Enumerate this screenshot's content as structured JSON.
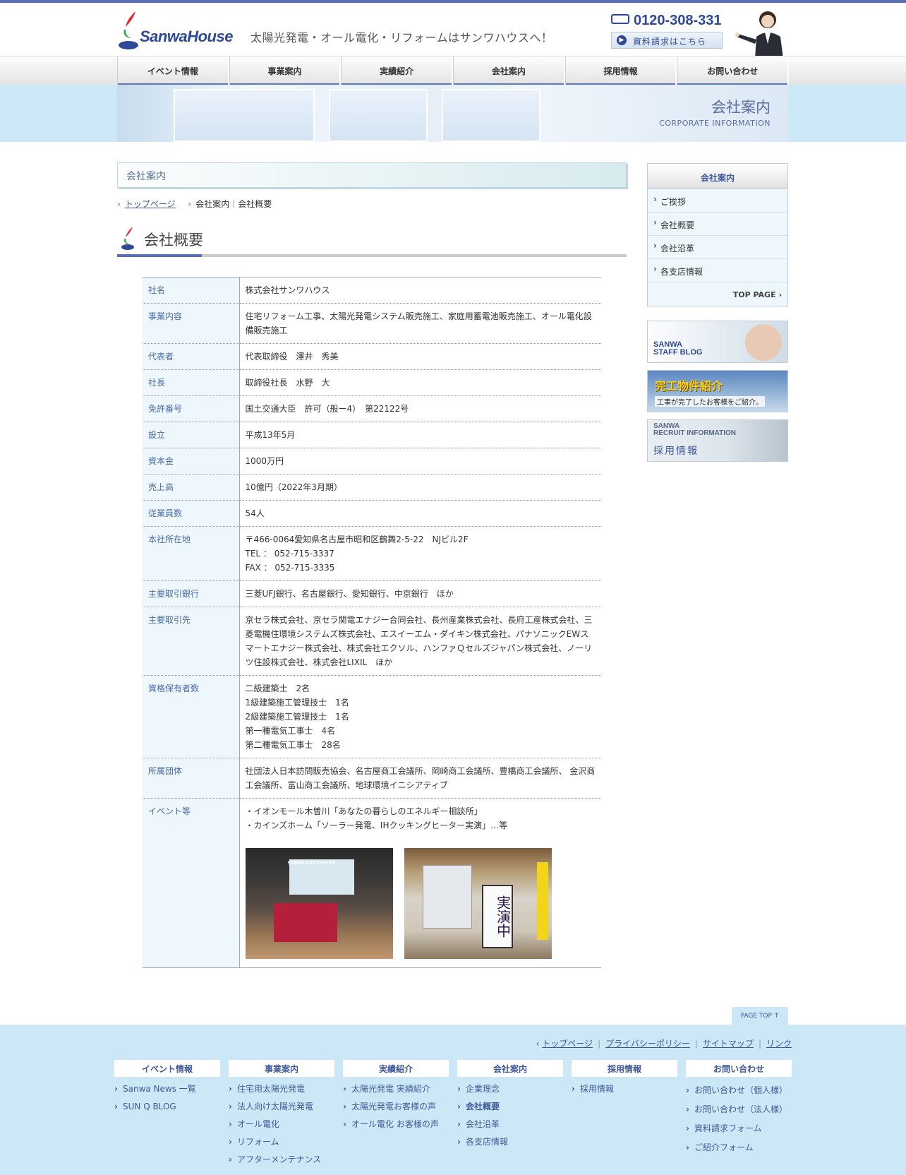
{
  "header": {
    "logo_text": "SanwaHouse",
    "tagline": "太陽光発電・オール電化・リフォームはサンワハウスへ！",
    "phone": "0120-308-331",
    "request_button": "資料請求はこちら"
  },
  "nav": [
    "イベント情報",
    "事業案内",
    "実績紹介",
    "会社案内",
    "採用情報",
    "お問い合わせ"
  ],
  "banner": {
    "title": "会社案内",
    "subtitle": "CORPORATE INFORMATION"
  },
  "section_bar": "会社案内",
  "breadcrumb": {
    "home": "トップページ",
    "current": "会社案内｜会社概要"
  },
  "page_title": "会社概要",
  "company": [
    {
      "label": "社名",
      "value": "株式会社サンワハウス"
    },
    {
      "label": "事業内容",
      "value": "住宅リフォーム工事、太陽光発電システム販売施工、家庭用蓄電池販売施工、オール電化設備販売施工"
    },
    {
      "label": "代表者",
      "value": "代表取締役　澤井　秀美"
    },
    {
      "label": "社長",
      "value": "取締役社長　水野　大"
    },
    {
      "label": "免許番号",
      "value": "国土交通大臣　許可（般ー4）　第22122号"
    },
    {
      "label": "設立",
      "value": "平成13年5月"
    },
    {
      "label": "資本金",
      "value": "1000万円"
    },
    {
      "label": "売上高",
      "value": "10億円（2022年3月期）"
    },
    {
      "label": "従業員数",
      "value": "54人"
    },
    {
      "label": "本社所在地",
      "line1": "〒466-0064愛知県名古屋市昭和区鶴舞2-5-22　NJビル2F",
      "line2": "TEL ： 052-715-3337",
      "line3": "FAX ： 052-715-3335"
    },
    {
      "label": "主要取引銀行",
      "value": "三菱UFJ銀行、名古屋銀行、愛知銀行、中京銀行　ほか"
    },
    {
      "label": "主要取引先",
      "value": "京セラ株式会社、京セラ関電エナジー合同会社、長州産業株式会社、長府工産株式会社、三菱電機住環境システムズ株式会社、エスイーエム・ダイキン株式会社、パナソニックEWスマートエナジー株式会社、株式会社エクソル、ハンファＱセルズジャパン株式会社、ノーリツ住設株式会社、株式会社LIXIL　ほか"
    },
    {
      "label": "資格保有者数",
      "line1": "二級建築士　2名",
      "line2": "1級建築施工管理技士　1名",
      "line3": "2級建築施工管理技士　1名",
      "line4": "第一種電気工事士　4名",
      "line5": "第二種電気工事士　28名"
    },
    {
      "label": "所属団体",
      "value": "社団法人日本訪問販売協会、名古屋商工会議所、岡崎商工会議所、豊橋商工会議所、 金沢商工会議所、富山商工会議所、地球環境イニシアティブ"
    },
    {
      "label": "イベント等",
      "line1": "・イオンモール木曽川「あなたの暮らしのエネルギー相談所」",
      "line2": "・カインズホーム「ソーラー発電、IHクッキングヒーター実演」…等",
      "photo1_caption": "STARBUCKS COFFEE",
      "photo2_caption": "実演中"
    }
  ],
  "sidebar": {
    "title": "会社案内",
    "items": [
      "ご挨拶",
      "会社概要",
      "会社沿革",
      "各支店情報"
    ],
    "top_page": "TOP PAGE",
    "banner1": {
      "line1": "SANWA",
      "line2": "STAFF BLOG"
    },
    "banner2": {
      "title": "完工物件紹介",
      "sub": "工事が完了したお客様をご紹介。"
    },
    "banner3": {
      "line1": "SANWA",
      "line2": "RECRUIT INFORMATION",
      "title": "採用情報"
    }
  },
  "page_top": "PAGE TOP",
  "footer": {
    "links": [
      "トップページ",
      "プライバシーポリシー",
      "サイトマップ",
      "リンク"
    ],
    "columns": [
      {
        "head": "イベント情報",
        "items": [
          "Sanwa News 一覧",
          "SUN Q BLOG"
        ]
      },
      {
        "head": "事業案内",
        "items": [
          "住宅用太陽光発電",
          "法人向け太陽光発電",
          "オール電化",
          "リフォーム",
          "アフターメンテナンス"
        ]
      },
      {
        "head": "実績紹介",
        "items": [
          "太陽光発電 実績紹介",
          "太陽光発電お客様の声",
          "オール電化 お客様の声"
        ]
      },
      {
        "head": "会社案内",
        "items": [
          "企業理念",
          "会社概要",
          "会社沿革",
          "各支店情報"
        ]
      },
      {
        "head": "採用情報",
        "items": [
          "採用情報"
        ]
      },
      {
        "head": "お問い合わせ",
        "items": [
          "お問い合わせ（個人様）",
          "お問い合わせ（法人様）",
          "資料請求フォーム",
          "ご紹介フォーム"
        ]
      }
    ]
  },
  "colors": {
    "accent": "#5a6fb0",
    "label_blue": "#476aa8",
    "footer_bg": "#cce8f6",
    "banner_bg": "#cce8f6"
  }
}
